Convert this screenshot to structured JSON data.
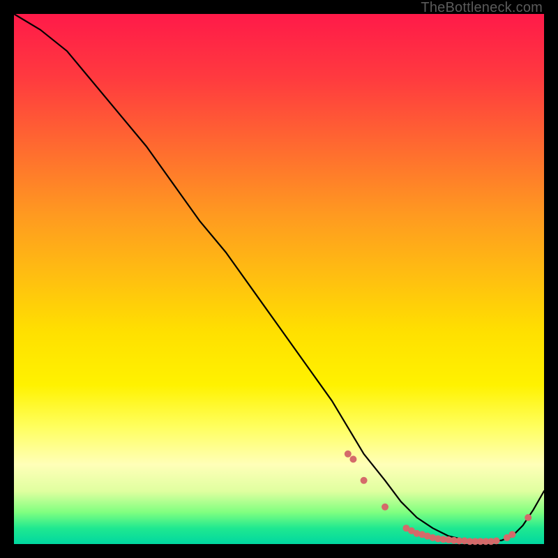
{
  "watermark": "TheBottleneck.com",
  "chart_data": {
    "type": "line",
    "title": "",
    "xlabel": "",
    "ylabel": "",
    "xlim": [
      0,
      100
    ],
    "ylim": [
      0,
      100
    ],
    "grid": false,
    "legend": false,
    "series": [
      {
        "name": "bottleneck-curve",
        "x": [
          0,
          5,
          10,
          15,
          20,
          25,
          30,
          35,
          40,
          45,
          50,
          55,
          60,
          63,
          66,
          70,
          73,
          76,
          79,
          82,
          85,
          88,
          90,
          92,
          94,
          96,
          98,
          100
        ],
        "y": [
          100,
          97,
          93,
          87,
          81,
          75,
          68,
          61,
          55,
          48,
          41,
          34,
          27,
          22,
          17,
          12,
          8,
          5,
          3,
          1.5,
          0.8,
          0.5,
          0.5,
          0.7,
          1.5,
          3.5,
          6.5,
          10
        ]
      }
    ],
    "highlight_points": {
      "name": "optimal-range-dots",
      "color": "#d46a6a",
      "x": [
        63,
        64,
        66,
        70,
        74,
        75,
        76,
        77,
        78,
        79,
        80,
        81,
        82,
        83,
        84,
        85,
        86,
        87,
        88,
        89,
        90,
        91,
        93,
        94,
        97
      ],
      "y": [
        17,
        16,
        12,
        7,
        3,
        2.5,
        2,
        1.8,
        1.5,
        1.2,
        1.0,
        0.9,
        0.8,
        0.7,
        0.6,
        0.6,
        0.5,
        0.5,
        0.5,
        0.5,
        0.5,
        0.6,
        1.2,
        1.8,
        5
      ]
    }
  }
}
